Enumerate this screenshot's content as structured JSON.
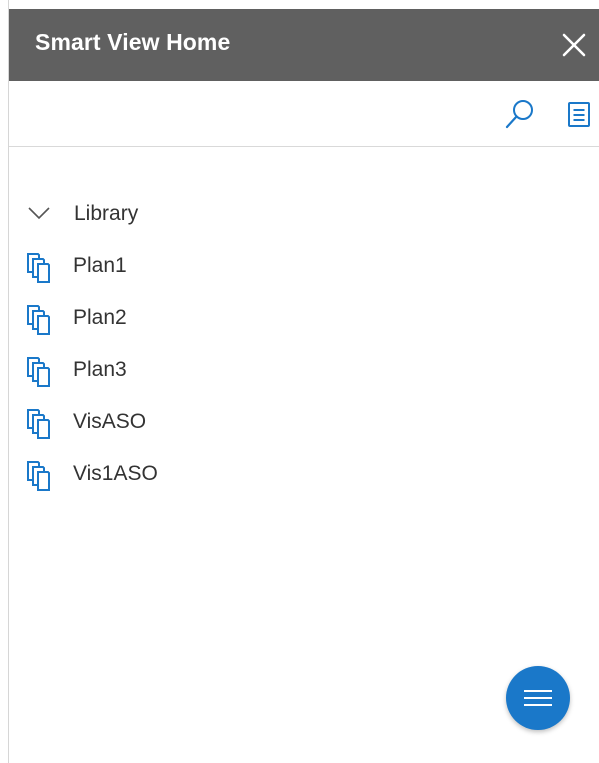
{
  "window": {
    "title": "Smart View Home",
    "close_icon": "close-icon"
  },
  "toolbar": {
    "search_icon": "search-icon",
    "list_icon": "list-icon"
  },
  "tree": {
    "root": {
      "label": "Library",
      "expanded": true,
      "icon": "chevron-down-icon"
    },
    "items": [
      {
        "label": "Plan1",
        "icon": "documents-icon"
      },
      {
        "label": "Plan2",
        "icon": "documents-icon"
      },
      {
        "label": "Plan3",
        "icon": "documents-icon"
      },
      {
        "label": "VisASO",
        "icon": "documents-icon"
      },
      {
        "label": "Vis1ASO",
        "icon": "documents-icon"
      }
    ]
  },
  "fab": {
    "icon": "menu-icon"
  },
  "colors": {
    "titlebar": "#606060",
    "accent": "#1a78c9",
    "text": "#333333"
  }
}
